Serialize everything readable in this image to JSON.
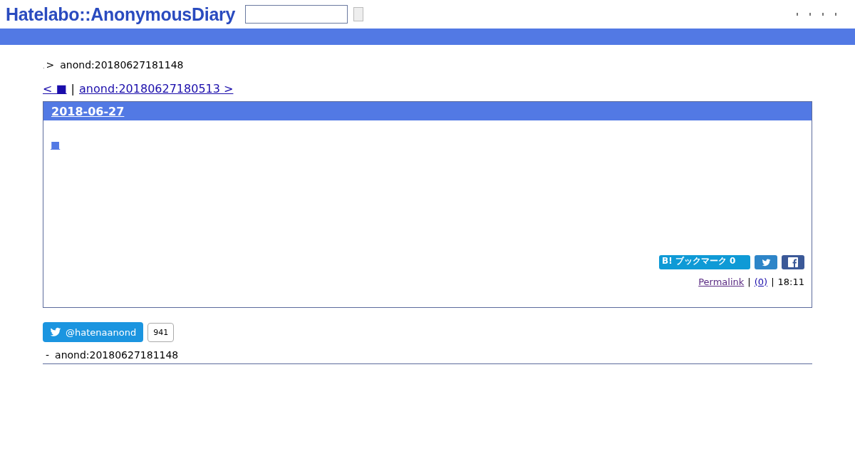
{
  "header": {
    "logo": "Hatelabo::AnonymousDiary"
  },
  "breadcrumb": {
    "home": ".",
    "separator": ">",
    "current": "anond:20180627181148"
  },
  "pager": {
    "prev": "< ■",
    "divider": "|",
    "next": "anond:20180627180513 >"
  },
  "entry": {
    "date": "2018-06-27",
    "body_link": "■",
    "bookmark": "B! ブックマーク 0",
    "footer": {
      "permalink": "Permalink",
      "sep1": "|",
      "comments": "(0)",
      "sep2": "|",
      "time": "18:11"
    }
  },
  "follow": {
    "handle": "@hatenaanond",
    "count": "941"
  },
  "refs": [
    {
      "bullet": "-",
      "text": "anond:20180627181148"
    }
  ]
}
